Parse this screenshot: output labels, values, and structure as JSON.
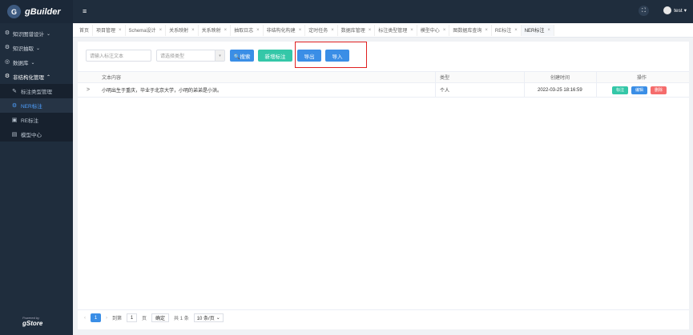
{
  "app": {
    "logo_mark": "G",
    "logo_text": "gBuilder"
  },
  "sidebar": {
    "items": [
      {
        "label": "知识图谱设计",
        "icon": "⚙",
        "arrow": "⌄"
      },
      {
        "label": "知识抽取",
        "icon": "⚙",
        "arrow": "⌄"
      },
      {
        "label": "数据库",
        "icon": "◎",
        "arrow": "⌄"
      },
      {
        "label": "非结构化管理",
        "icon": "⚙",
        "arrow": "⌃"
      }
    ],
    "sub_items": [
      {
        "label": "标注类型管理",
        "icon": "✎"
      },
      {
        "label": "NER标注",
        "icon": "⚙"
      },
      {
        "label": "RE标注",
        "icon": "▣"
      },
      {
        "label": "模型中心",
        "icon": "▤"
      }
    ],
    "powered_small": "Powered by",
    "powered_text": "gStore"
  },
  "header": {
    "hamburger": "≡",
    "fullscreen": "⛶",
    "user": "test",
    "user_arrow": "▾"
  },
  "tabs": [
    {
      "label": "首页"
    },
    {
      "label": "项目管理"
    },
    {
      "label": "Schema设计"
    },
    {
      "label": "关系映射"
    },
    {
      "label": "关系映射"
    },
    {
      "label": "抽取日志"
    },
    {
      "label": "非结构化构建"
    },
    {
      "label": "定时任务"
    },
    {
      "label": "数据库管理"
    },
    {
      "label": "标注类型管理"
    },
    {
      "label": "模型中心"
    },
    {
      "label": "图数据库查询"
    },
    {
      "label": "RE标注"
    },
    {
      "label": "NER标注"
    }
  ],
  "tab_close": "×",
  "toolbar": {
    "search_placeholder": "请输入标注文本",
    "type_placeholder": "请选择类型",
    "select_arrow": "▾",
    "search_btn": "🔍搜索",
    "add_btn": "新增标注",
    "export_btn": "导出",
    "import_btn": "导入"
  },
  "table": {
    "headers": [
      "文本内容",
      "类型",
      "创建时间",
      "操作"
    ],
    "expand_icon": ">",
    "rows": [
      {
        "text": "小明出生于重庆，毕业于北京大学，小明的弟弟是小洪。",
        "type": "个人",
        "time": "2022-03-25 18:16:59"
      }
    ],
    "ops": {
      "label": "标注",
      "edit": "编辑",
      "delete": "删除"
    }
  },
  "pager": {
    "prev": "‹",
    "page": "1",
    "next": "›",
    "goto": "到第",
    "goto_value": "1",
    "page_unit": "页",
    "confirm": "确定",
    "total": "共 1 条",
    "size": "10 条/页",
    "size_arrow": "⌄"
  },
  "colors": {
    "sidebar": "#1f2d3d",
    "primary": "#3a8ee6",
    "teal": "#34c7a8",
    "danger": "#f56c6c",
    "highlight": "#e02020"
  }
}
